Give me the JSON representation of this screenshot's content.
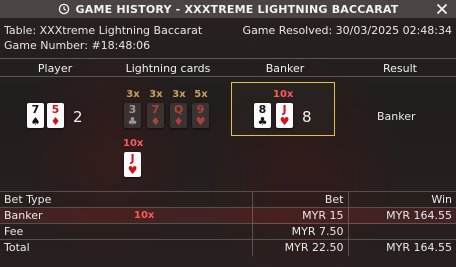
{
  "window": {
    "title": "GAME HISTORY - XXXTREME LIGHTNING BACCARAT",
    "icons": {
      "history": "history-icon",
      "close": "close-icon"
    }
  },
  "meta": {
    "table": "Table: XXXtreme Lightning Baccarat",
    "game_number": "Game Number: #18:48:06",
    "resolved": "Game Resolved: 30/03/2025 02:48:34"
  },
  "columns": {
    "player": "Player",
    "lightning": "Lightning cards",
    "banker": "Banker",
    "result": "Result"
  },
  "player": {
    "cards": [
      {
        "rank": "7",
        "suit": "♠",
        "color": "black"
      },
      {
        "rank": "5",
        "suit": "♦",
        "color": "red"
      }
    ],
    "score": "2"
  },
  "lightning": {
    "cards": [
      {
        "mult": "3x",
        "rank": "3",
        "suit": "♣",
        "color": "black"
      },
      {
        "mult": "3x",
        "rank": "7",
        "suit": "♦",
        "color": "red"
      },
      {
        "mult": "3x",
        "rank": "Q",
        "suit": "♦",
        "color": "red"
      },
      {
        "mult": "5x",
        "rank": "9",
        "suit": "♥",
        "color": "red"
      }
    ],
    "extra": {
      "mult": "10x",
      "rank": "J",
      "suit": "♥",
      "color": "red"
    }
  },
  "banker": {
    "mult": "10x",
    "cards": [
      {
        "rank": "8",
        "suit": "♣",
        "color": "black"
      },
      {
        "rank": "J",
        "suit": "♥",
        "color": "red"
      }
    ],
    "score": "8"
  },
  "result": "Banker",
  "bets": {
    "headers": {
      "type": "Bet Type",
      "bet": "Bet",
      "win": "Win"
    },
    "rows": [
      {
        "type": "Banker",
        "mult": "10x",
        "bet": "MYR 15",
        "win": "MYR 164.55"
      },
      {
        "type": "Fee",
        "mult": "",
        "bet": "MYR 7.50",
        "win": ""
      },
      {
        "type": "Total",
        "mult": "",
        "bet": "MYR 22.50",
        "win": "MYR 164.55"
      }
    ]
  },
  "colors": {
    "highlight_border": "#e2c046",
    "multiplier_red": "#ff5a5a",
    "multiplier_gold": "#c9a15e"
  }
}
